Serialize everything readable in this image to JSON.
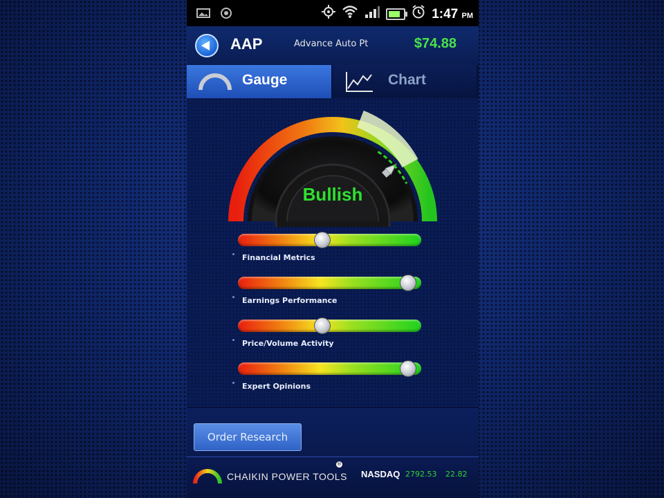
{
  "statusbar": {
    "time": "1:47",
    "ampm": "PM"
  },
  "header": {
    "ticker": "AAP",
    "company": "Advance Auto Pt",
    "price": "$74.88"
  },
  "tabs": [
    {
      "label": "Gauge",
      "active": true
    },
    {
      "label": "Chart",
      "active": false
    }
  ],
  "gauge": {
    "sentiment": "Bullish"
  },
  "factors": [
    {
      "label": "Financial Metrics",
      "level": 0.46
    },
    {
      "label": "Earnings Performance",
      "level": 0.93
    },
    {
      "label": "Price/Volume Activity",
      "level": 0.46
    },
    {
      "label": "Expert Opinions",
      "level": 0.93
    }
  ],
  "actions": {
    "order_research": "Order Research"
  },
  "bottombar": {
    "brand": "CHAIKIN POWER TOOLS",
    "index_name": "NASDAQ",
    "index_value": "2792.53",
    "index_change": "22.82"
  },
  "colors": {
    "bullish": "#2ee02e",
    "price": "#4be24b",
    "accent": "#3a77e0"
  },
  "icons": [
    "image-icon",
    "circle-icon",
    "gps-icon",
    "wifi-icon",
    "signal-icon",
    "battery-icon",
    "alarm-icon",
    "back-arrow-icon",
    "gauge-arc-icon",
    "line-chart-icon",
    "chaikin-logo-icon"
  ]
}
